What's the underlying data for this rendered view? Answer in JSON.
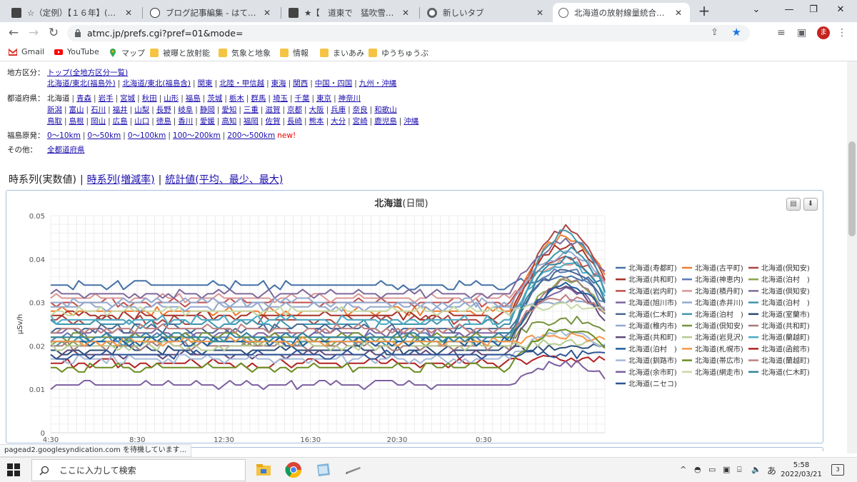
{
  "browser": {
    "tabs": [
      {
        "title": "☆（定例）【１６年】(？？",
        "icon": "thumbnail-icon"
      },
      {
        "title": "ブログ記事編集 - はてなブログ",
        "icon": "hatena-icon"
      },
      {
        "title": "★【　道東で　猛吹雪　】★／",
        "icon": "thumbnail-icon"
      },
      {
        "title": "新しいタブ",
        "icon": "chrome-icon"
      },
      {
        "title": "北海道の放射線量統合グラフ",
        "icon": "globe-icon"
      }
    ],
    "new_tab": "+",
    "window": {
      "minimize": "⌄",
      "min2": "—",
      "restore": "❐",
      "close": "✕"
    },
    "url": "atmc.jp/prefs.cgi?pref=01&mode=",
    "avatar_letter": "ま",
    "bookmarks": [
      {
        "label": "Gmail",
        "icon": "gmail-icon"
      },
      {
        "label": "YouTube",
        "icon": "youtube-icon"
      },
      {
        "label": "マップ",
        "icon": "maps-icon"
      },
      {
        "label": "被曝と放射能",
        "icon": "folder-icon"
      },
      {
        "label": "気象と地象",
        "icon": "folder-icon"
      },
      {
        "label": "情報",
        "icon": "folder-icon"
      },
      {
        "label": "まいあみ",
        "icon": "folder-icon"
      },
      {
        "label": "ゆうちゅうぶ",
        "icon": "folder-icon"
      }
    ]
  },
  "nav": {
    "region_label": "地方区分：",
    "region_links": [
      [
        "トップ(全地方区分一覧)"
      ],
      [
        "北海道/東北(福島外)",
        "北海道/東北(福島含)",
        "関東",
        "北陸・甲信越",
        "東海",
        "関西",
        "中国・四国",
        "九州・沖縄"
      ]
    ],
    "pref_label": "都道府県：",
    "pref_current": "北海道",
    "pref_links": [
      [
        "青森",
        "岩手",
        "宮城",
        "秋田",
        "山形",
        "福島",
        "茨城",
        "栃木",
        "群馬",
        "埼玉",
        "千葉",
        "東京",
        "神奈川"
      ],
      [
        "新潟",
        "富山",
        "石川",
        "福井",
        "山梨",
        "長野",
        "岐阜",
        "静岡",
        "愛知",
        "三重",
        "滋賀",
        "京都",
        "大阪",
        "兵庫",
        "奈良",
        "和歌山"
      ],
      [
        "鳥取",
        "島根",
        "岡山",
        "広島",
        "山口",
        "徳島",
        "香川",
        "愛媛",
        "高知",
        "福岡",
        "佐賀",
        "長崎",
        "熊本",
        "大分",
        "宮崎",
        "鹿児島",
        "沖縄"
      ]
    ],
    "fukushima_label": "福島原発：",
    "fukushima_links": [
      "0〜10km",
      "0〜50km",
      "0〜100km",
      "100〜200km",
      "200〜500km"
    ],
    "new_tag": "new!",
    "other_label": "その他：",
    "other_links": [
      "全都道府県"
    ]
  },
  "view_tabs": {
    "current": "時系列(実数値)",
    "links": [
      "時系列(増減率)",
      "統計値(平均、最少、最大)"
    ]
  },
  "chart_data": {
    "type": "line",
    "title": "北海道",
    "subtitle": "(日間)",
    "ylabel": "μSv/h",
    "ylim": [
      0,
      0.05
    ],
    "yticks": [
      "0",
      "0.01",
      "0.02",
      "0.03",
      "0.04",
      "0.05"
    ],
    "xticks": [
      "4:30",
      "8:30",
      "12:30",
      "16:30",
      "20:30",
      "0:30"
    ],
    "grid": true,
    "legend_position": "right",
    "n_points": 100,
    "series": [
      {
        "name": "北海道(寿都町)",
        "color": "#4572a7",
        "base": 0.034,
        "peak": 0.036
      },
      {
        "name": "北海道(古平町)",
        "color": "#ed7d31",
        "base": 0.028,
        "peak": 0.045
      },
      {
        "name": "北海道(倶知安)",
        "color": "#aa4643",
        "base": 0.026,
        "peak": 0.047
      },
      {
        "name": "北海道(共和町)",
        "color": "#a93226",
        "base": 0.027,
        "peak": 0.043
      },
      {
        "name": "北海道(神恵内)",
        "color": "#5b7db8",
        "base": 0.022,
        "peak": 0.038
      },
      {
        "name": "北海道(泊村　)",
        "color": "#89a54e",
        "base": 0.021,
        "peak": 0.035
      },
      {
        "name": "北海道(岩内町)",
        "color": "#c0504d",
        "base": 0.03,
        "peak": 0.04
      },
      {
        "name": "北海道(積丹町)",
        "color": "#d99694",
        "base": 0.031,
        "peak": 0.039
      },
      {
        "name": "北海道(倶知安)",
        "color": "#80699b",
        "base": 0.032,
        "peak": 0.044
      },
      {
        "name": "北海道(旭川市)",
        "color": "#8064a2",
        "base": 0.023,
        "peak": 0.033
      },
      {
        "name": "北海道(赤井川)",
        "color": "#93a9cf",
        "base": 0.03,
        "peak": 0.041
      },
      {
        "name": "北海道(泊村　)",
        "color": "#3d96ae",
        "base": 0.025,
        "peak": 0.042
      },
      {
        "name": "北海道(仁木町)",
        "color": "#4a6890",
        "base": 0.024,
        "peak": 0.037
      },
      {
        "name": "北海道(泊村　)",
        "color": "#4198af",
        "base": 0.021,
        "peak": 0.046
      },
      {
        "name": "北海道(室蘭市)",
        "color": "#2c4d75",
        "base": 0.019,
        "peak": 0.02
      },
      {
        "name": "北海道(稚内市)",
        "color": "#92a8cd",
        "base": 0.029,
        "peak": 0.03
      },
      {
        "name": "北海道(倶知安)",
        "color": "#77933c",
        "base": 0.022,
        "peak": 0.026
      },
      {
        "name": "北海道(共和町)",
        "color": "#a47d7c",
        "base": 0.02,
        "peak": 0.035
      },
      {
        "name": "北海道(共和町)",
        "color": "#604a7b",
        "base": 0.018,
        "peak": 0.034
      },
      {
        "name": "北海道(岩見沢)",
        "color": "#b5ca92",
        "base": 0.02,
        "peak": 0.021
      },
      {
        "name": "北海道(蘭越町)",
        "color": "#4bacc6",
        "base": 0.026,
        "peak": 0.039
      },
      {
        "name": "北海道(泊村　)",
        "color": "#1f5f9e",
        "base": 0.021,
        "peak": 0.034
      },
      {
        "name": "北海道(札幌市)",
        "color": "#f79646",
        "base": 0.021,
        "peak": 0.022
      },
      {
        "name": "北海道(函館市)",
        "color": "#b22222",
        "base": 0.016,
        "peak": 0.017
      },
      {
        "name": "北海道(釧路市)",
        "color": "#a5b8d9",
        "base": 0.017,
        "peak": 0.023
      },
      {
        "name": "北海道(帯広市)",
        "color": "#6b8e23",
        "base": 0.015,
        "peak": 0.024
      },
      {
        "name": "北海道(蘭越町)",
        "color": "#c08080",
        "base": 0.024,
        "peak": 0.031
      },
      {
        "name": "北海道(余市町)",
        "color": "#7d5fa0",
        "base": 0.011,
        "peak": 0.016
      },
      {
        "name": "北海道(網走市)",
        "color": "#c7d9a5",
        "base": 0.028,
        "peak": 0.029
      },
      {
        "name": "北海道(仁木町)",
        "color": "#31859c",
        "base": 0.022,
        "peak": 0.04
      },
      {
        "name": "北海道(ニセコ)",
        "color": "#2f5597",
        "base": 0.018,
        "peak": 0.018
      }
    ]
  },
  "status_bubble": "pagead2.googlesyndication.com を待機しています...",
  "taskbar": {
    "search_placeholder": "ここに入力して検索",
    "time": "5:58",
    "date": "2022/03/21",
    "ime": "あ",
    "notif_count": "3"
  }
}
